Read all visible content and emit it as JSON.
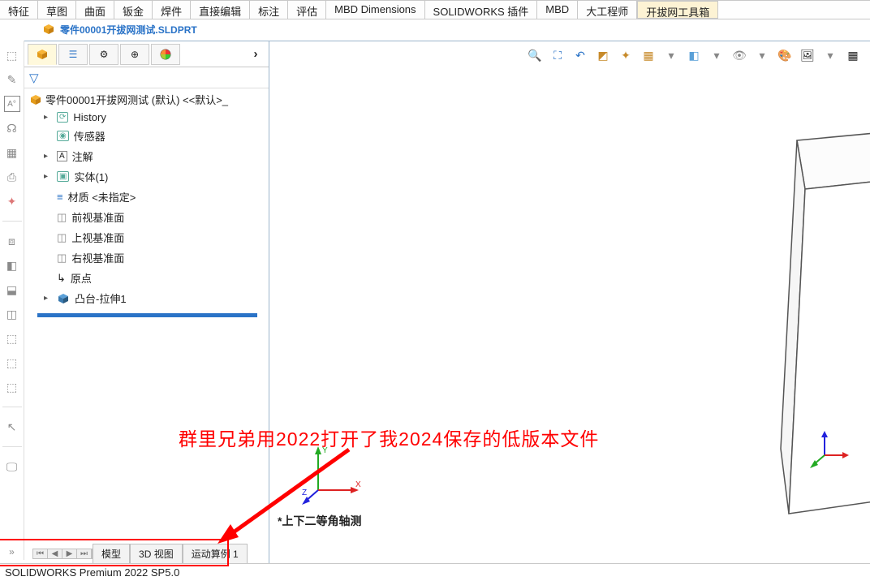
{
  "ribbon": {
    "tabs": [
      "特征",
      "草图",
      "曲面",
      "钣金",
      "焊件",
      "直接编辑",
      "标注",
      "评估",
      "MBD Dimensions",
      "SOLIDWORKS 插件",
      "MBD",
      "大工程师",
      "开拔网工具箱"
    ]
  },
  "doc": {
    "title": "零件00001开拔网测试.SLDPRT"
  },
  "tree": {
    "root": "零件00001开拔网测试 (默认) <<默认>_",
    "items": [
      {
        "label": "History"
      },
      {
        "label": "传感器"
      },
      {
        "label": "注解",
        "caret": true
      },
      {
        "label": "实体(1)",
        "caret": true
      },
      {
        "label": "材质 <未指定>"
      },
      {
        "label": "前视基准面"
      },
      {
        "label": "上视基准面"
      },
      {
        "label": "右视基准面"
      },
      {
        "label": "原点"
      },
      {
        "label": "凸台-拉伸1",
        "caret": true
      }
    ]
  },
  "viewport": {
    "label": "*上下二等角轴测"
  },
  "bottom_tabs": {
    "t1": "模型",
    "t2": "3D 视图",
    "t3": "运动算例 1"
  },
  "status": {
    "text": "SOLIDWORKS Premium 2022 SP5.0"
  },
  "annotation": {
    "text": "群里兄弟用2022打开了我2024保存的低版本文件"
  }
}
